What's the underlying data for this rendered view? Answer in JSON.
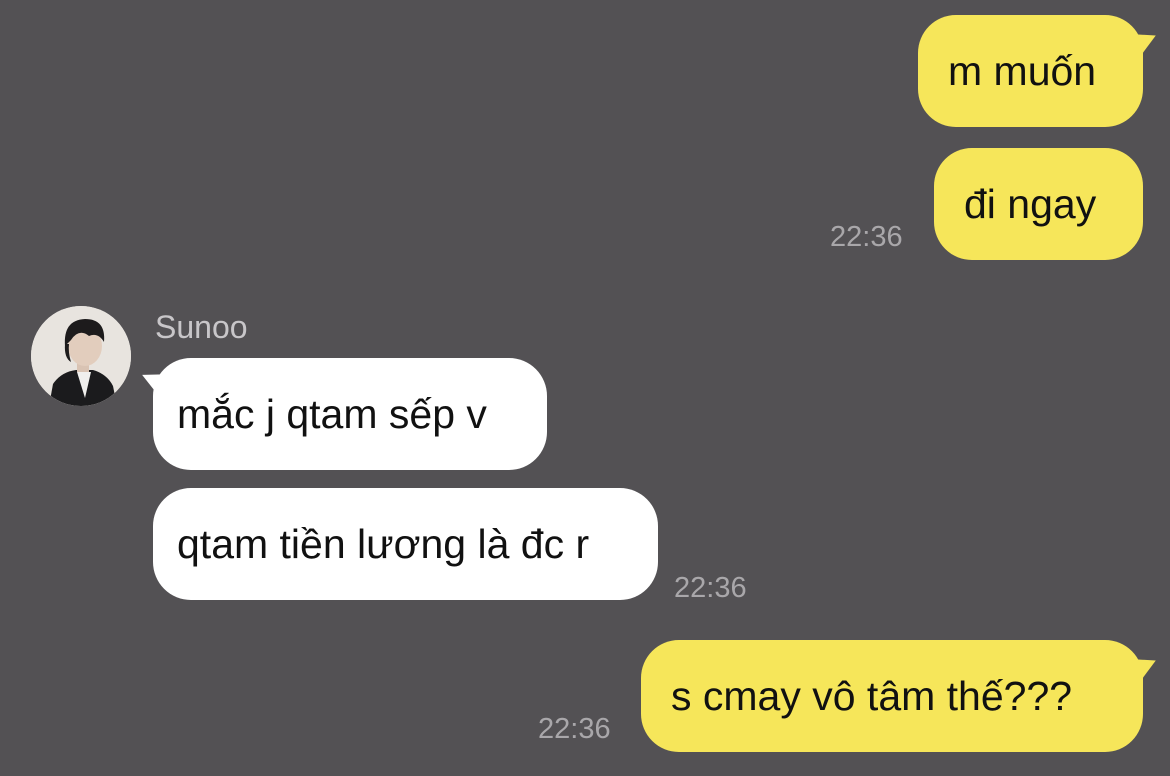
{
  "chat": {
    "contact_name": "Sunoo",
    "messages": [
      {
        "side": "outgoing",
        "text": "m muốn"
      },
      {
        "side": "outgoing",
        "text": "đi ngay",
        "time": "22:36"
      },
      {
        "side": "incoming",
        "text": "mắc j qtam sếp v"
      },
      {
        "side": "incoming",
        "text": "qtam tiền lương là đc r",
        "time": "22:36"
      },
      {
        "side": "outgoing",
        "text": "s cmay vô tâm thế???",
        "time": "22:36"
      }
    ]
  },
  "colors": {
    "background": "#535154",
    "outgoing_bubble": "#f6e65a",
    "incoming_bubble": "#ffffff",
    "timestamp": "#a9a7aa"
  },
  "icons": {
    "avatar": "profile-photo"
  }
}
